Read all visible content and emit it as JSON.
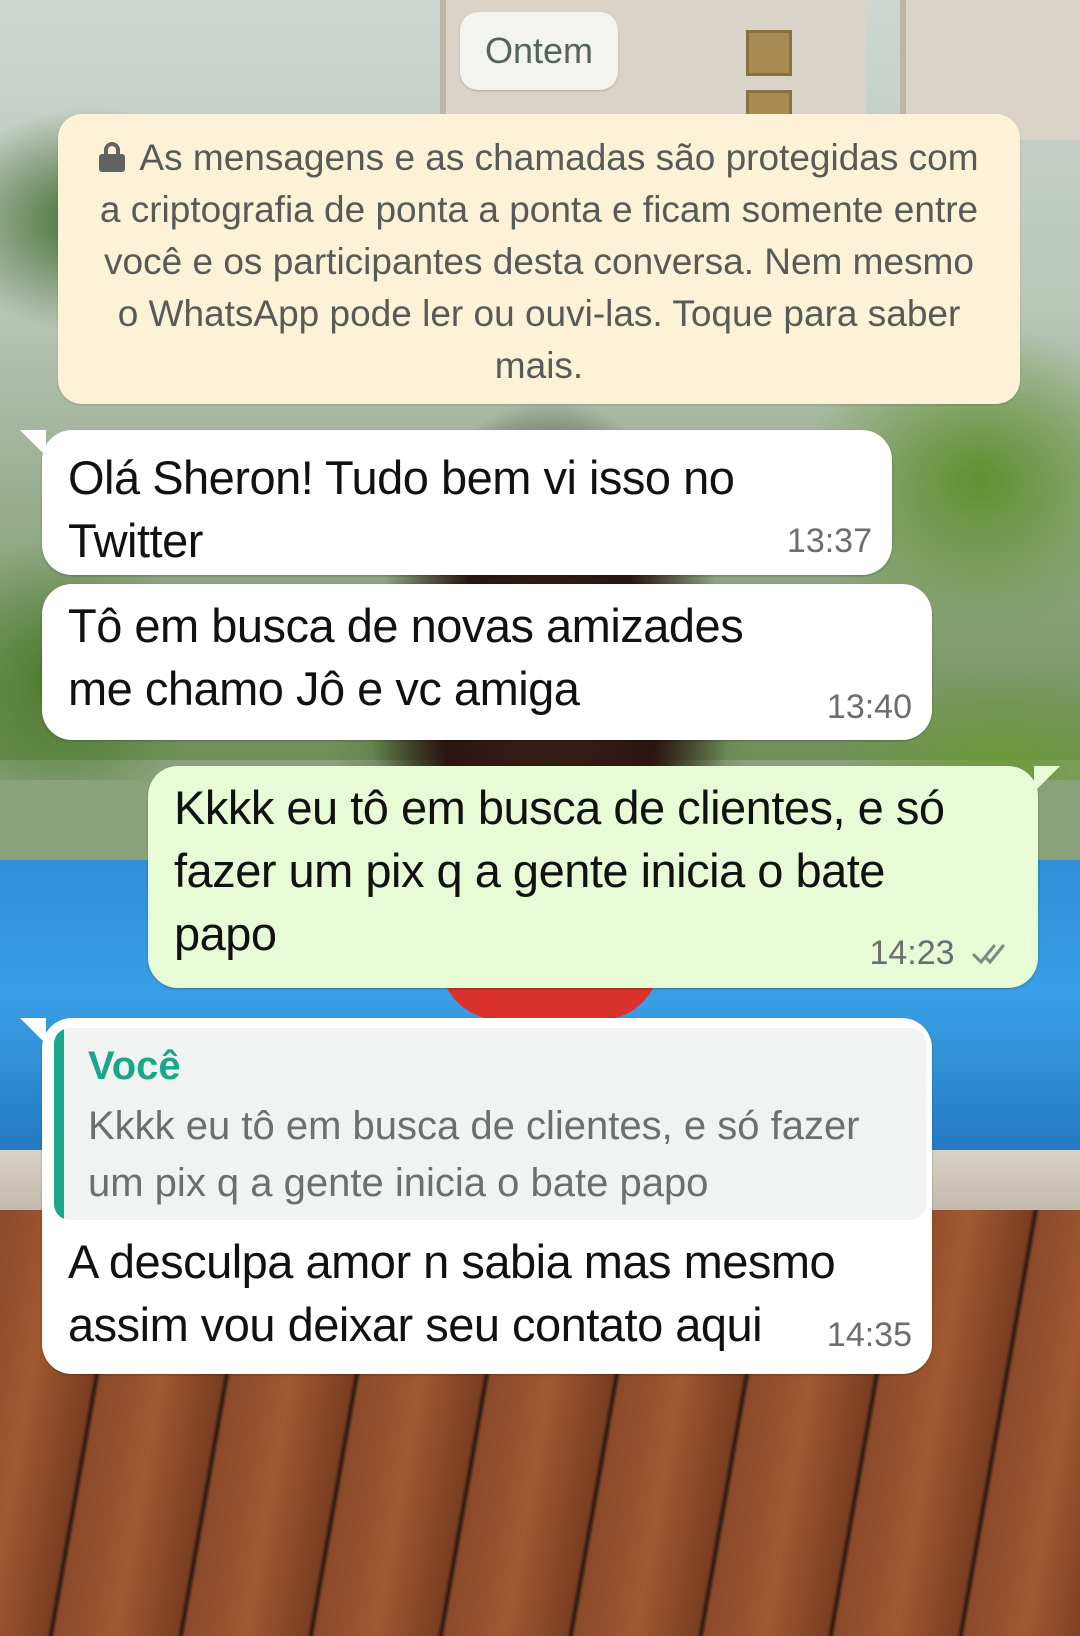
{
  "chat": {
    "date_chip": "Ontem",
    "encryption_notice": "As mensagens e as chamadas são protegidas com a criptografia de ponta a ponta e ficam somente entre você e os participantes desta conversa. Nem mesmo o WhatsApp pode ler ou ouvi-las. Toque para saber mais.",
    "messages": [
      {
        "direction": "incoming",
        "text": "Olá Sheron! Tudo bem vi isso no Twitter",
        "time": "13:37"
      },
      {
        "direction": "incoming",
        "text": "Tô em busca de novas amizades me chamo Jô e vc amiga",
        "time": "13:40"
      },
      {
        "direction": "outgoing",
        "text": "Kkkk eu tô em busca de clientes,  e só fazer um pix q a gente inicia o bate papo",
        "time": "14:23",
        "status_icon": "double-check-icon"
      },
      {
        "direction": "incoming",
        "quoted": {
          "author": "Você",
          "text": "Kkkk eu tô em busca de clientes,  e só fazer um pix q a gente inicia o bate papo"
        },
        "text": "A desculpa amor n sabia mas mesmo assim vou deixar seu contato aqui",
        "time": "14:35"
      }
    ]
  },
  "colors": {
    "incoming_bubble": "#ffffff",
    "outgoing_bubble": "#e7fcd6",
    "notice_bg": "#fdf2d7",
    "quote_accent": "#1aa68a",
    "timestamp": "#6d6d6d"
  }
}
